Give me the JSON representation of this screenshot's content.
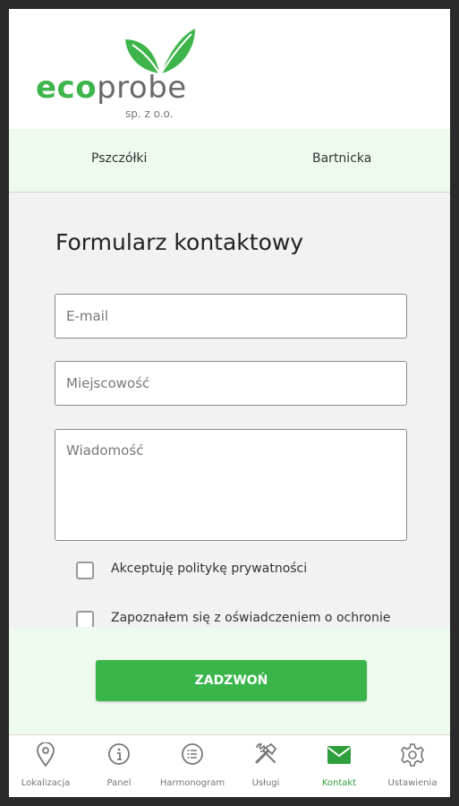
{
  "brand": {
    "name_part1": "eco",
    "name_part2": "probe",
    "subtitle": "sp. z o.o.",
    "icon": "leaf-icon",
    "color": "#3db54a"
  },
  "locations": [
    "Pszczółki",
    "Bartnicka"
  ],
  "form": {
    "title": "Formularz kontaktowy",
    "email_placeholder": "E-mail",
    "city_placeholder": "Miejscowość",
    "message_placeholder": "Wiadomość",
    "checkbox1_label": "Akceptuję politykę prywatności",
    "checkbox2_label": "Zapoznałem się z oświadczeniem o ochronie",
    "call_button": "ZADZWOŃ"
  },
  "tabs": [
    {
      "label": "Lokalizacja",
      "icon": "location-pin-icon"
    },
    {
      "label": "Panel",
      "icon": "info-icon"
    },
    {
      "label": "Harmonogram",
      "icon": "list-icon"
    },
    {
      "label": "Usługi",
      "icon": "tools-icon"
    },
    {
      "label": "Kontakt",
      "icon": "envelope-icon",
      "active": true
    },
    {
      "label": "Ustawienia",
      "icon": "gear-icon"
    }
  ],
  "colors": {
    "accent": "#39b54a",
    "light_green_bg": "#effaee",
    "active_tab": "#2f9e3c"
  }
}
